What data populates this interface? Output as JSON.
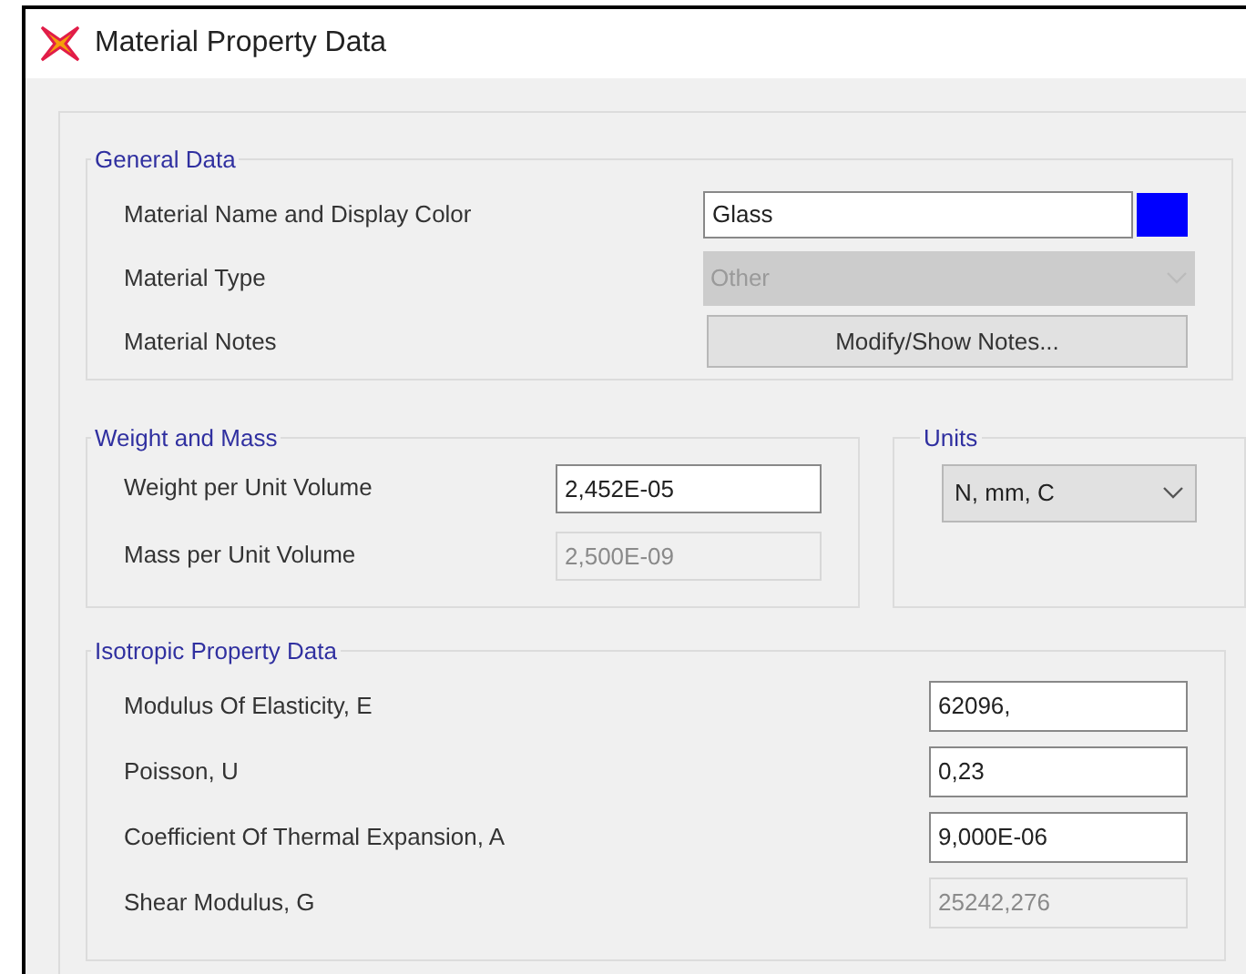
{
  "window": {
    "title": "Material Property Data"
  },
  "general_data": {
    "title": "General Data",
    "material_name": {
      "label": "Material Name and Display Color",
      "value": "Glass",
      "color": "#0000ff"
    },
    "material_type": {
      "label": "Material Type",
      "value": "Other",
      "disabled": true
    },
    "material_notes": {
      "label": "Material Notes",
      "button": "Modify/Show Notes..."
    }
  },
  "weight_and_mass": {
    "title": "Weight and Mass",
    "fields": [
      {
        "label": "Weight per Unit Volume",
        "value": "2,452E-05",
        "disabled": false
      },
      {
        "label": "Mass per Unit Volume",
        "value": "2,500E-09",
        "disabled": true
      }
    ]
  },
  "units": {
    "title": "Units",
    "value": "N, mm, C"
  },
  "isotropic_property_data": {
    "title": "Isotropic Property Data",
    "fields": [
      {
        "label": "Modulus Of Elasticity,  E",
        "value": "62096,",
        "disabled": false
      },
      {
        "label": "Poisson, U",
        "value": "0,23",
        "disabled": false
      },
      {
        "label": "Coefficient Of Thermal Expansion,  A",
        "value": "9,000E-06",
        "disabled": false
      },
      {
        "label": "Shear Modulus,  G",
        "value": "25242,276",
        "disabled": true
      }
    ]
  }
}
